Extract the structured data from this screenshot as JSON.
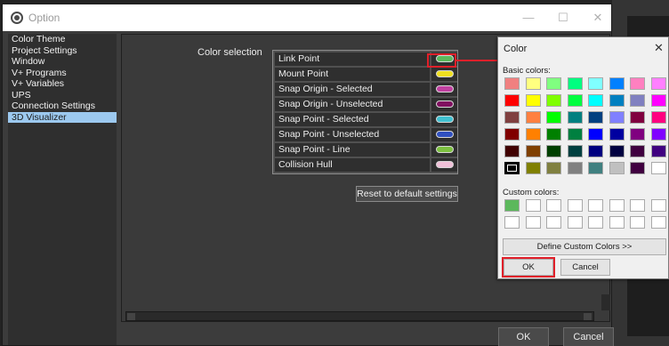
{
  "window": {
    "title": "Option",
    "minimize_glyph": "—",
    "maximize_glyph": "☐",
    "close_glyph": "✕"
  },
  "nav": {
    "items": [
      {
        "label": "Color Theme",
        "selected": false
      },
      {
        "label": "Project Settings",
        "selected": false
      },
      {
        "label": "Window",
        "selected": false
      },
      {
        "label": "V+ Programs",
        "selected": false
      },
      {
        "label": "V+ Variables",
        "selected": false
      },
      {
        "label": "UPS",
        "selected": false
      },
      {
        "label": "Connection Settings",
        "selected": false
      },
      {
        "label": "3D Visualizer",
        "selected": true
      }
    ]
  },
  "color_selection": {
    "label": "Color selection",
    "rows": [
      {
        "label": "Link Point",
        "color": "#5cb85c"
      },
      {
        "label": "Mount Point",
        "color": "#f0e020"
      },
      {
        "label": "Snap Origin - Selected",
        "color": "#c040a0"
      },
      {
        "label": "Snap Origin - Unselected",
        "color": "#801060"
      },
      {
        "label": "Snap Point - Selected",
        "color": "#40c0d0"
      },
      {
        "label": "Snap Point - Unselected",
        "color": "#3050c0"
      },
      {
        "label": "Snap Point - Line",
        "color": "#7cc040"
      },
      {
        "label": "Collision Hull",
        "color": "#f0c0d8"
      }
    ],
    "reset_label": "Reset to default settings"
  },
  "footer": {
    "ok_label": "OK",
    "cancel_label": "Cancel"
  },
  "color_dialog": {
    "title": "Color",
    "close_glyph": "✕",
    "basic_label": "Basic colors:",
    "basic_colors": [
      [
        "#f08080",
        "#ffff80",
        "#80ff80",
        "#00ff80",
        "#80ffff",
        "#0080ff",
        "#ff80c0",
        "#ff80ff"
      ],
      [
        "#ff0000",
        "#ffff00",
        "#80ff00",
        "#00ff40",
        "#00ffff",
        "#0080c0",
        "#8080c0",
        "#ff00ff"
      ],
      [
        "#804040",
        "#ff8040",
        "#00ff00",
        "#008080",
        "#004080",
        "#8080ff",
        "#800040",
        "#ff0080"
      ],
      [
        "#800000",
        "#ff8000",
        "#008000",
        "#008040",
        "#0000ff",
        "#0000a0",
        "#800080",
        "#8000ff"
      ],
      [
        "#400000",
        "#804000",
        "#004000",
        "#004040",
        "#000080",
        "#000040",
        "#400040",
        "#400080"
      ],
      [
        "#000000",
        "#808000",
        "#808040",
        "#808080",
        "#408080",
        "#c0c0c0",
        "#400040",
        "#ffffff"
      ]
    ],
    "selected_basic": [
      5,
      0
    ],
    "custom_label": "Custom colors:",
    "custom_colors": [
      [
        "#5cb85c",
        "#ffffff",
        "#ffffff",
        "#ffffff",
        "#ffffff",
        "#ffffff",
        "#ffffff",
        "#ffffff"
      ],
      [
        "#ffffff",
        "#ffffff",
        "#ffffff",
        "#ffffff",
        "#ffffff",
        "#ffffff",
        "#ffffff",
        "#ffffff"
      ]
    ],
    "define_label": "Define Custom Colors >>",
    "ok_label": "OK",
    "cancel_label": "Cancel"
  }
}
